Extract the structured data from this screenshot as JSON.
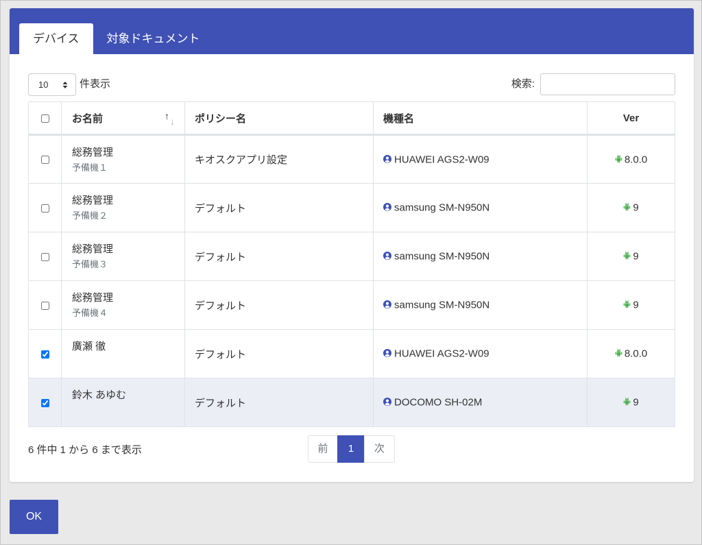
{
  "colors": {
    "primary": "#3f51b5",
    "android": "#4caf50",
    "row_highlight": "#eceef5",
    "border": "#dee2e6",
    "muted": "#6c757d"
  },
  "tabs": [
    {
      "label": "デバイス",
      "active": true
    },
    {
      "label": "対象ドキュメント",
      "active": false
    }
  ],
  "length_menu": {
    "value": "10",
    "suffix": "件表示",
    "icon": "up-down-caret-icon"
  },
  "search": {
    "label": "検索:",
    "value": ""
  },
  "table": {
    "select_all_checked": false,
    "columns": {
      "name": "お名前",
      "policy": "ポリシー名",
      "model": "機種名",
      "ver": "Ver"
    },
    "sort_icon": "sort-icon",
    "model_icon": "user-circle-icon",
    "ver_icon": "android-icon",
    "rows": [
      {
        "checked": false,
        "highlighted": false,
        "name": "総務管理",
        "sub": "予備機１",
        "policy": "キオスクアプリ設定",
        "model": "HUAWEI AGS2-W09",
        "ver": "8.0.0"
      },
      {
        "checked": false,
        "highlighted": false,
        "name": "総務管理",
        "sub": "予備機２",
        "policy": "デフォルト",
        "model": "samsung SM-N950N",
        "ver": "9"
      },
      {
        "checked": false,
        "highlighted": false,
        "name": "総務管理",
        "sub": "予備機３",
        "policy": "デフォルト",
        "model": "samsung SM-N950N",
        "ver": "9"
      },
      {
        "checked": false,
        "highlighted": false,
        "name": "総務管理",
        "sub": "予備機４",
        "policy": "デフォルト",
        "model": "samsung SM-N950N",
        "ver": "9"
      },
      {
        "checked": true,
        "highlighted": false,
        "name": "廣瀬 徹",
        "policy": "デフォルト",
        "model": "HUAWEI AGS2-W09",
        "ver": "8.0.0"
      },
      {
        "checked": true,
        "highlighted": true,
        "name": "鈴木 あゆむ",
        "policy": "デフォルト",
        "model": "DOCOMO SH-02M",
        "ver": "9"
      }
    ]
  },
  "info": "6 件中 1 から 6 まで表示",
  "pagination": {
    "prev": "前",
    "pages": [
      {
        "label": "1",
        "active": true
      }
    ],
    "next": "次"
  },
  "ok_button": "OK"
}
